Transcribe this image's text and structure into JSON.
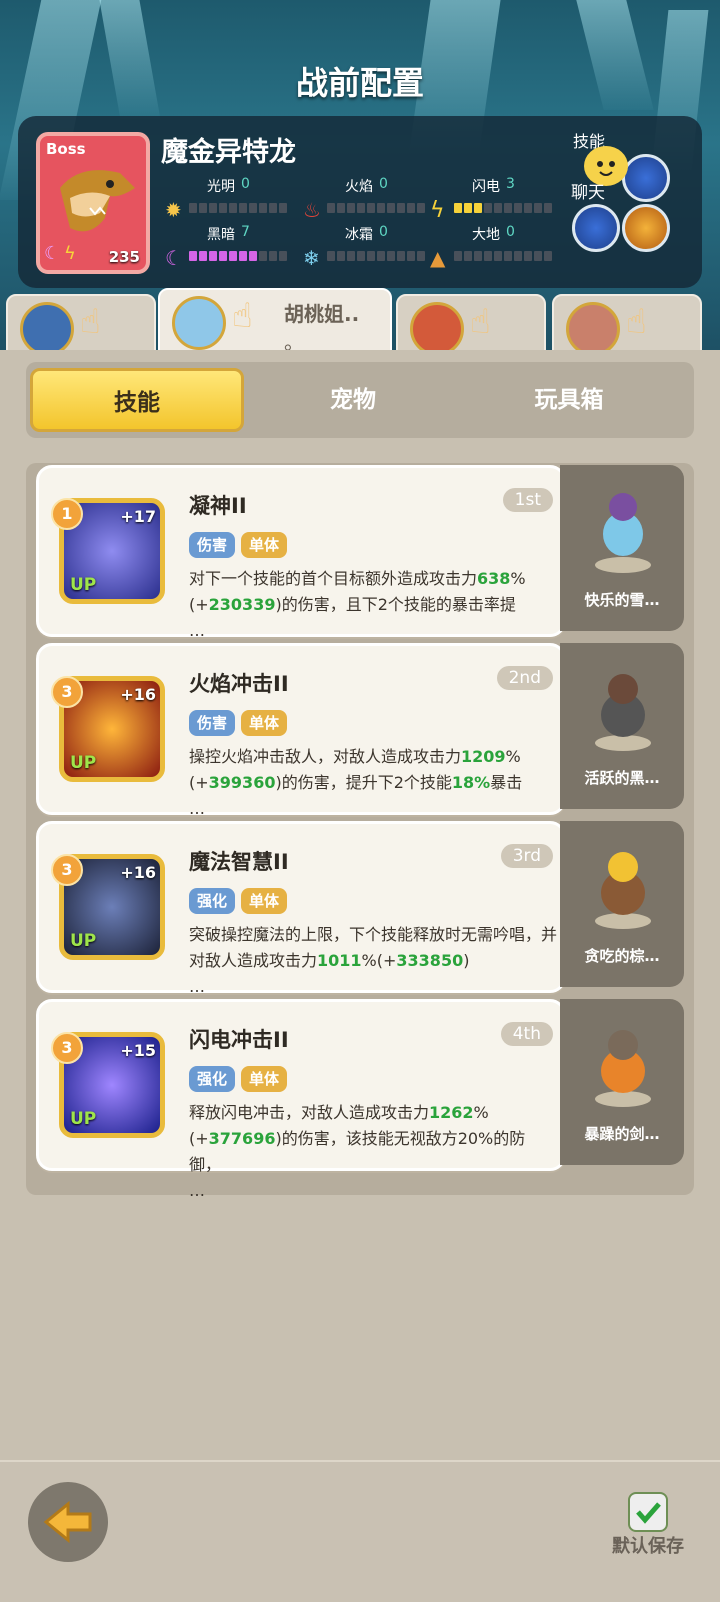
{
  "header": {
    "title": "战前配置"
  },
  "boss": {
    "tag": "Boss",
    "name": "魔金异特龙",
    "level": "235",
    "stats": [
      {
        "label": "光明",
        "value": "0",
        "filled": 0,
        "color": "#f6c54a"
      },
      {
        "label": "火焰",
        "value": "0",
        "filled": 0,
        "color": "#e3453a"
      },
      {
        "label": "闪电",
        "value": "3",
        "filled": 3,
        "color": "#f6d23a"
      },
      {
        "label": "黑暗",
        "value": "7",
        "filled": 7,
        "color": "#d565e6"
      },
      {
        "label": "冰霜",
        "value": "0",
        "filled": 0,
        "color": "#7fd0ee"
      },
      {
        "label": "大地",
        "value": "0",
        "filled": 0,
        "color": "#e69a3a"
      }
    ],
    "skills_label": "技能",
    "chat_label": "聊天"
  },
  "hero_tabs": [
    {
      "name": "",
      "active": false
    },
    {
      "name": "胡桃姐..",
      "name2": "。",
      "active": true
    },
    {
      "name": "",
      "active": false
    },
    {
      "name": "",
      "active": false
    }
  ],
  "segments": {
    "skill": "技能",
    "pet": "宠物",
    "toybox": "玩具箱",
    "selected": "技能"
  },
  "skills": [
    {
      "num": "1",
      "plus": "+17",
      "up": "UP",
      "name": "凝神II",
      "order": "1st",
      "tag1": "伤害",
      "tag2": "单体",
      "desc_a": "对下一个技能的首个目标额外造成攻击力",
      "desc_b": "638",
      "desc_c": "%(+",
      "desc_d": "230339",
      "desc_e": ")的伤害，且下2个技能的暴击率提",
      "desc_f": "…",
      "pet": "快乐的雪…",
      "color1": "#2a2e8c",
      "color2": "#8f8cf0"
    },
    {
      "num": "3",
      "plus": "+16",
      "up": "UP",
      "name": "火焰冲击II",
      "order": "2nd",
      "tag1": "伤害",
      "tag2": "单体",
      "desc_a": "操控火焰冲击敌人，对敌人造成攻击力",
      "desc_b": "1209",
      "desc_c": "%(+",
      "desc_d": "399360",
      "desc_e": ")的伤害，提升下2个技能",
      "desc_g": "18%",
      "desc_h": "暴击",
      "desc_f": "…",
      "pet": "活跃的黑…",
      "color1": "#8a1a10",
      "color2": "#ffb63a"
    },
    {
      "num": "3",
      "plus": "+16",
      "up": "UP",
      "name": "魔法智慧II",
      "order": "3rd",
      "tag1": "强化",
      "tag2": "单体",
      "desc_a": "突破操控魔法的上限，下个技能释放时无需吟唱，并对敌人造成攻击力",
      "desc_b": "1011",
      "desc_c": "%(+",
      "desc_d": "333850",
      "desc_e": ")",
      "desc_f": "…",
      "pet": "贪吃的棕…",
      "color1": "#1c2238",
      "color2": "#6c7fb8"
    },
    {
      "num": "3",
      "plus": "+15",
      "up": "UP",
      "name": "闪电冲击II",
      "order": "4th",
      "tag1": "强化",
      "tag2": "单体",
      "desc_a": "释放闪电冲击，对敌人造成攻击力",
      "desc_b": "1262",
      "desc_c": "%(+",
      "desc_d": "377696",
      "desc_e": ")的伤害，该技能无视敌方20%的防御，",
      "desc_f": "…",
      "pet": "暴躁的剑…",
      "color1": "#1a1f8a",
      "color2": "#9f86ff"
    }
  ],
  "footer": {
    "save_label": "默认保存"
  }
}
